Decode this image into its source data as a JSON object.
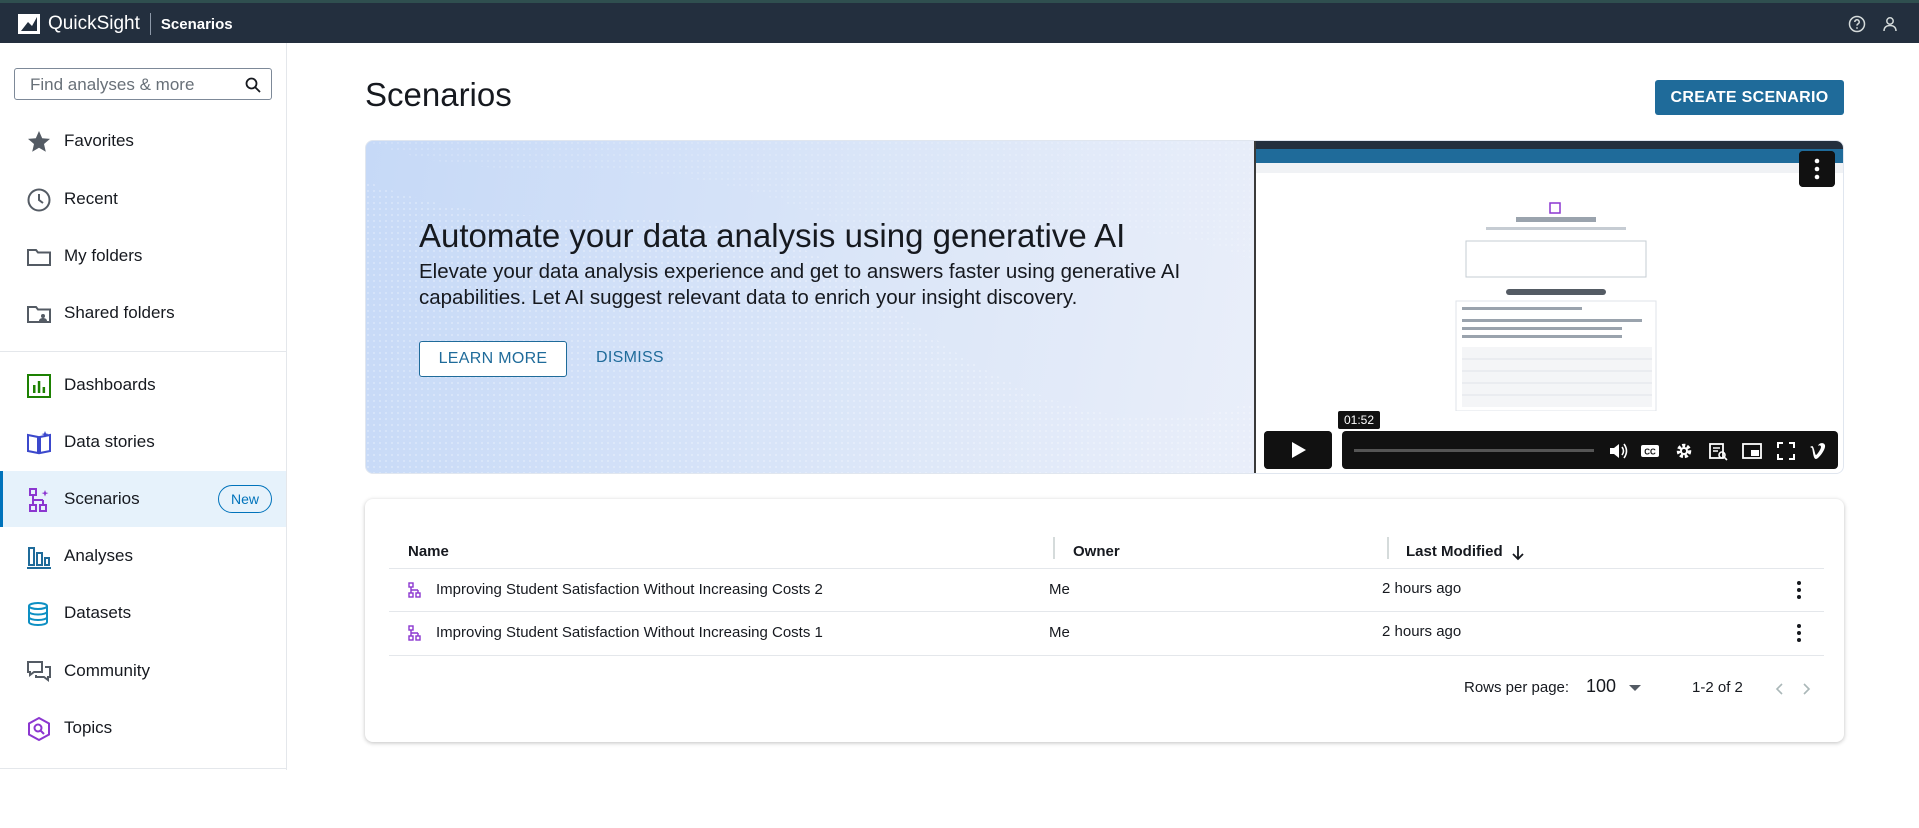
{
  "topbar": {
    "app_name": "QuickSight",
    "context": "Scenarios"
  },
  "search": {
    "placeholder": "Find analyses & more"
  },
  "sidebar": {
    "items": [
      {
        "label": "Favorites"
      },
      {
        "label": "Recent"
      },
      {
        "label": "My folders"
      },
      {
        "label": "Shared folders"
      },
      {
        "label": "Dashboards"
      },
      {
        "label": "Data stories"
      },
      {
        "label": "Scenarios",
        "badge": "New"
      },
      {
        "label": "Analyses"
      },
      {
        "label": "Datasets"
      },
      {
        "label": "Community"
      },
      {
        "label": "Topics"
      }
    ],
    "active": "Scenarios"
  },
  "main": {
    "title": "Scenarios",
    "create_button": "CREATE SCENARIO"
  },
  "banner": {
    "title": "Automate your data analysis using generative AI",
    "description": "Elevate your data analysis experience and get to answers faster using generative AI capabilities. Let AI suggest relevant data to enrich your insight discovery.",
    "learn_more": "LEARN MORE",
    "dismiss": "DISMISS",
    "video": {
      "timestamp": "01:52",
      "progress": 0.0
    }
  },
  "table": {
    "columns": [
      "Name",
      "Owner",
      "Last Modified"
    ],
    "sort": {
      "column": "Last Modified",
      "direction": "descending"
    },
    "rows": [
      {
        "name": "Improving Student Satisfaction Without Increasing Costs 2",
        "owner": "Me",
        "modified": "2 hours ago"
      },
      {
        "name": "Improving Student Satisfaction Without Increasing Costs 1",
        "owner": "Me",
        "modified": "2 hours ago"
      }
    ],
    "footer": {
      "rows_per_page_label": "Rows per page:",
      "rows_per_page": "100",
      "range": "1-2 of 2"
    }
  },
  "colors": {
    "topbar": "#232f3e",
    "primary": "#1f6b9a",
    "active_bg": "#e6f2fb",
    "scenario_icon": "#8c37d0"
  }
}
